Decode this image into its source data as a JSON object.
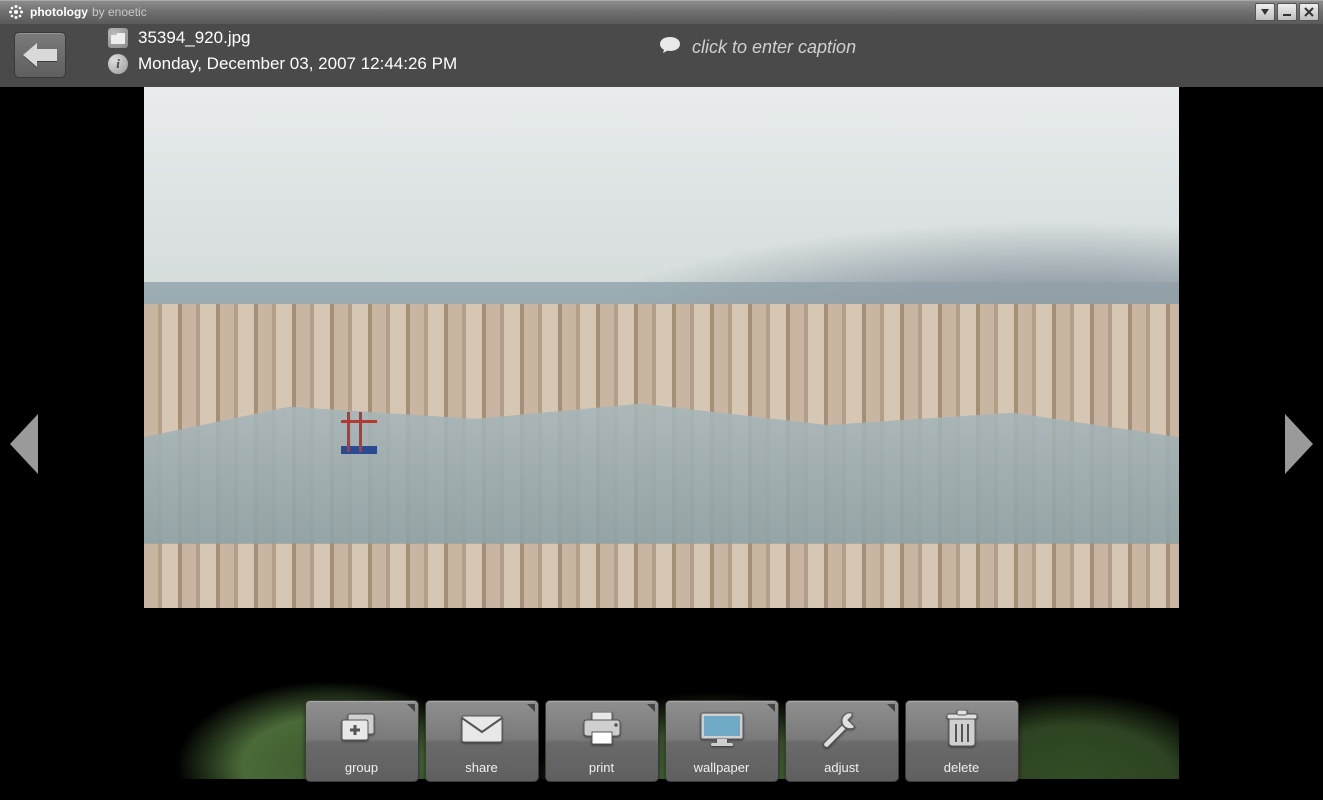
{
  "titlebar": {
    "app_name": "photology",
    "by_label": "by enoetic"
  },
  "header": {
    "filename": "35394_920.jpg",
    "datetime": "Monday, December 03, 2007 12:44:26 PM",
    "caption_placeholder": "click to enter caption"
  },
  "toolbar": {
    "group": "group",
    "share": "share",
    "print": "print",
    "wallpaper": "wallpaper",
    "adjust": "adjust",
    "delete": "delete"
  }
}
